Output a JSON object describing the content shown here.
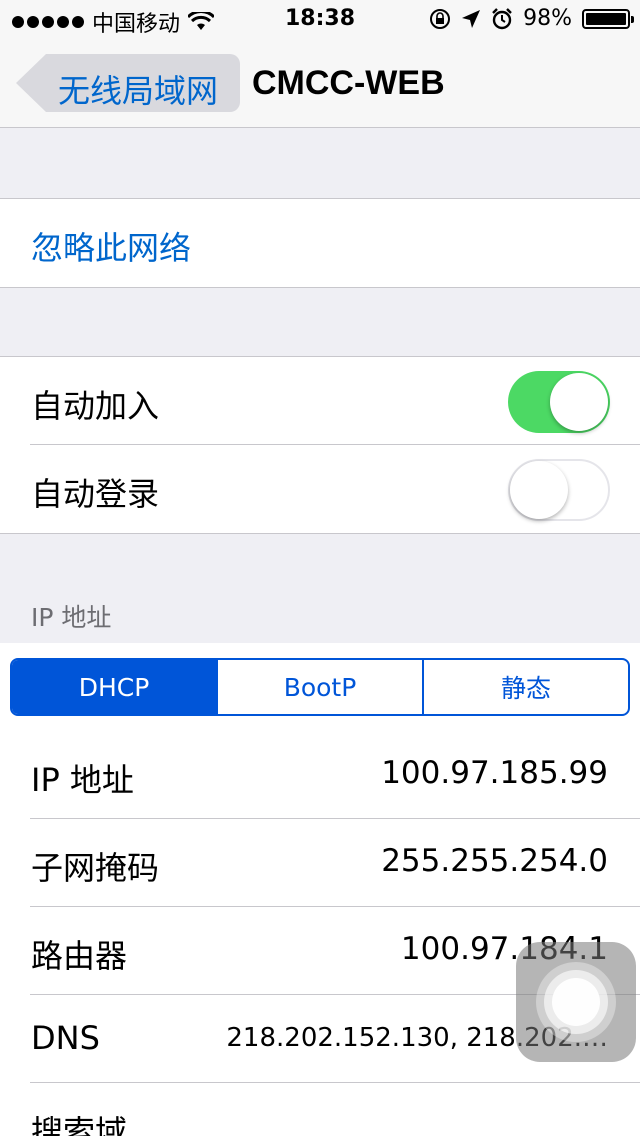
{
  "status_bar": {
    "carrier": "中国移动",
    "time": "18:38",
    "battery_percent": "98%"
  },
  "nav": {
    "back_label": "无线局域网",
    "title": "CMCC-WEB"
  },
  "forget": {
    "label": "忽略此网络"
  },
  "toggles": [
    {
      "label": "自动加入",
      "on": true
    },
    {
      "label": "自动登录",
      "on": false
    }
  ],
  "ip_section": {
    "header": "IP 地址",
    "segments": [
      "DHCP",
      "BootP",
      "静态"
    ],
    "selected_segment": "DHCP",
    "rows": [
      {
        "label": "IP 地址",
        "value": "100.97.185.99"
      },
      {
        "label": "子网掩码",
        "value": "255.255.254.0"
      },
      {
        "label": "路由器",
        "value": "100.97.184.1"
      },
      {
        "label": "DNS",
        "value": "218.202.152.130, 218.202.…"
      },
      {
        "label": "搜索域",
        "value": ""
      }
    ]
  },
  "colors": {
    "accent_blue": "#0066cc",
    "segment_blue": "#0055d8",
    "switch_on": "#4cd964",
    "background": "#efeff4"
  },
  "icons": [
    "signal-dots-icon",
    "wifi-icon",
    "rotation-lock-icon",
    "location-arrow-icon",
    "alarm-icon",
    "battery-icon",
    "back-chevron-icon",
    "assistive-touch-icon"
  ]
}
